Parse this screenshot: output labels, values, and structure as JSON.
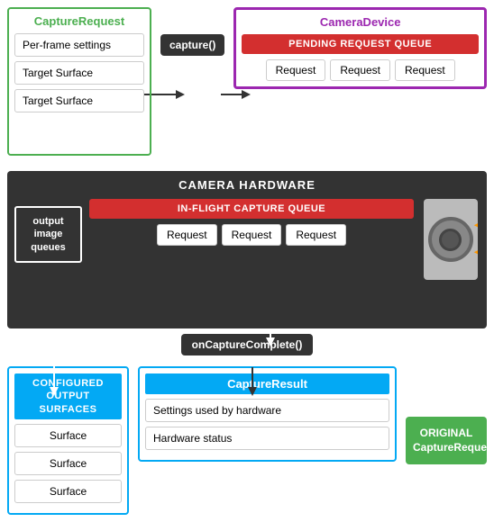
{
  "diagram": {
    "capture_request": {
      "title": "CaptureRequest",
      "title_color": "#4CAF50",
      "items": [
        {
          "label": "Per-frame settings"
        },
        {
          "label": "Target Surface"
        },
        {
          "label": "Target Surface"
        }
      ]
    },
    "capture_btn": {
      "label": "capture()"
    },
    "camera_device": {
      "title": "CameraDevice",
      "title_color": "#9C27B0",
      "pending_queue": {
        "label": "PENDING REQUEST QUEUE"
      },
      "requests": [
        "Request",
        "Request",
        "Request"
      ]
    },
    "camera_hardware": {
      "title": "CAMERA HARDWARE",
      "output_image_queues": "output image\nqueues",
      "inflight_queue": {
        "label": "IN-FLIGHT CAPTURE QUEUE"
      },
      "requests": [
        "Request",
        "Request",
        "Request"
      ]
    },
    "on_capture_complete": {
      "label": "onCaptureComplete()"
    },
    "configured_surfaces": {
      "title": "CONFIGURED OUTPUT\nSURFACES",
      "items": [
        "Surface",
        "Surface",
        "Surface"
      ]
    },
    "capture_result": {
      "title": "CaptureResult",
      "items": [
        {
          "label": "Settings used by hardware"
        },
        {
          "label": "Hardware status"
        }
      ]
    },
    "original_capture": {
      "line1": "ORIGINAL",
      "line2": "CaptureRequest"
    }
  }
}
